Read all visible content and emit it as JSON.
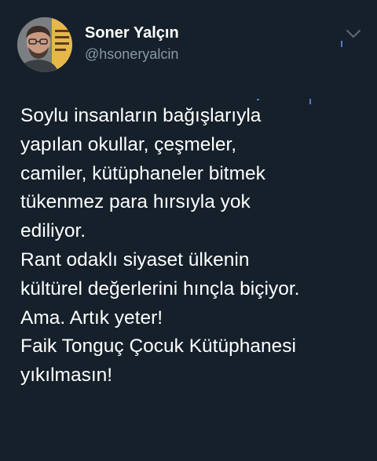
{
  "author": {
    "name": "Soner Yalçın",
    "handle": "@hsoneryalcin"
  },
  "tweet": {
    "lines": [
      "Soylu insanların bağışlarıyla",
      "yapılan okullar, çeşmeler,",
      "camiler, kütüphaneler bitmek",
      "tükenmez para hırsıyla yok",
      "ediliyor.",
      "Rant odaklı siyaset ülkenin",
      "kültürel değerlerini hınçla biçiyor.",
      "Ama. Artık yeter!",
      "Faik Tonguç Çocuk Kütüphanesi",
      "yıkılmasın!"
    ]
  },
  "icons": {
    "menu": "chevron-down-icon"
  },
  "colors": {
    "background": "#15202b",
    "text": "#ffffff",
    "secondary_text": "#8899a6"
  }
}
